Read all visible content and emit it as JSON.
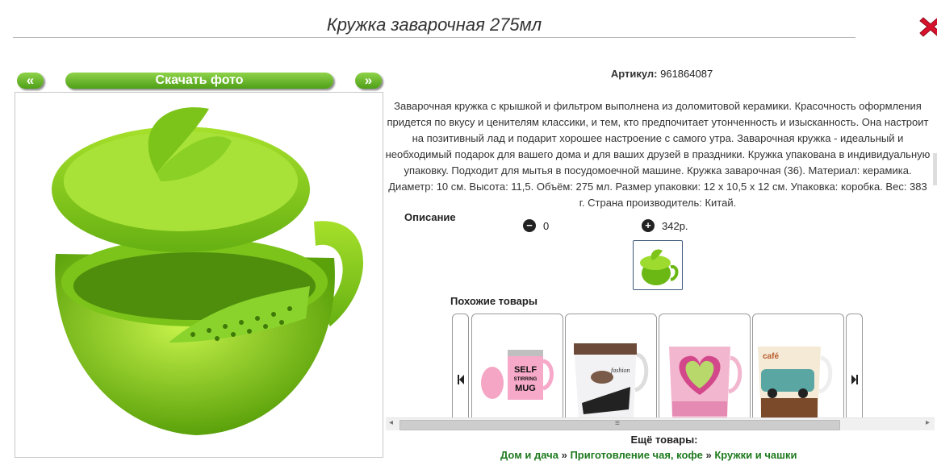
{
  "title": "Кружка заварочная 275мл",
  "nav": {
    "prev_label": "«",
    "next_label": "»",
    "download_label": "Скачать фото"
  },
  "article": {
    "label": "Артикул:",
    "value": "961864087"
  },
  "description": "Заварочная кружка с крышкой и фильтром выполнена из доломитовой керамики. Красочность оформления придется по вкусу и ценителям классики, и тем, кто предпочитает утонченность и изысканность. Она настроит на позитивный лад и подарит хорошее настроение с самого утра. Заварочная кружка - идеальный и необходимый подарок для вашего дома и для ваших друзей в праздники. Кружка упакована в индивидуальную упаковку. Подходит для мытья в посудомоечной машине. Кружка заварочная (36). Материал: керамика. Диаметр: 10 см. Высота: 11,5. Объём: 275 мл. Размер упаковки: 12 х 10,5 х 12 см. Упаковка: коробка. Вес: 383 г. Страна производитель: Китай.",
  "description_label": "Описание",
  "quantity": {
    "minus_icon": "−",
    "value": "0",
    "plus_icon": "+",
    "price": "342р."
  },
  "similar": {
    "title": "Похожие товары",
    "prev_icon": "◀",
    "next_icon": "▶",
    "items": [
      {
        "image": "self-stirring-mug",
        "text": "SELF STIRRING MUG"
      },
      {
        "image": "fashion-mug",
        "text": "fashion"
      },
      {
        "image": "heart-mug",
        "text": ""
      },
      {
        "image": "cafe-car-mug",
        "text": "café"
      }
    ]
  },
  "scrollbar": {
    "left_icon": "◂",
    "right_icon": "▸",
    "grip": "≡"
  },
  "more": {
    "title": "Ещё товары:",
    "crumbs": [
      "Дом и дача",
      "Приготовление чая, кофе",
      "Кружки и чашки"
    ],
    "separator": "»"
  },
  "colors": {
    "accent_green": "#5fae1e",
    "link_green": "#1f7a1f",
    "close_red": "#c8102e"
  }
}
